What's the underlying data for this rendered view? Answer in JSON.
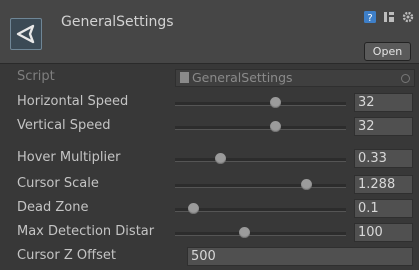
{
  "header": {
    "title": "GeneralSettings",
    "open_label": "Open",
    "icons": [
      "book-help-icon",
      "layout-icon",
      "gear-icon"
    ]
  },
  "script_row": {
    "label": "Script",
    "value": "GeneralSettings"
  },
  "fields": [
    {
      "label": "Horizontal Speed",
      "value": "32",
      "slider_fraction": 0.59
    },
    {
      "label": "Vertical Speed",
      "value": "32",
      "slider_fraction": 0.59
    },
    {
      "label": "Hover Multiplier",
      "value": "0.33",
      "slider_fraction": 0.27
    },
    {
      "label": "Cursor Scale",
      "value": "1.288",
      "slider_fraction": 0.77
    },
    {
      "label": "Dead Zone",
      "value": "0.1",
      "slider_fraction": 0.11
    },
    {
      "label": "Max Detection Distar",
      "value": "100",
      "slider_fraction": 0.41
    },
    {
      "label": "Cursor Z Offset",
      "value": "500"
    }
  ],
  "colors": {
    "background": "#383838",
    "header": "#464646",
    "field": "#505050",
    "help_icon": "#3e7fc8"
  }
}
